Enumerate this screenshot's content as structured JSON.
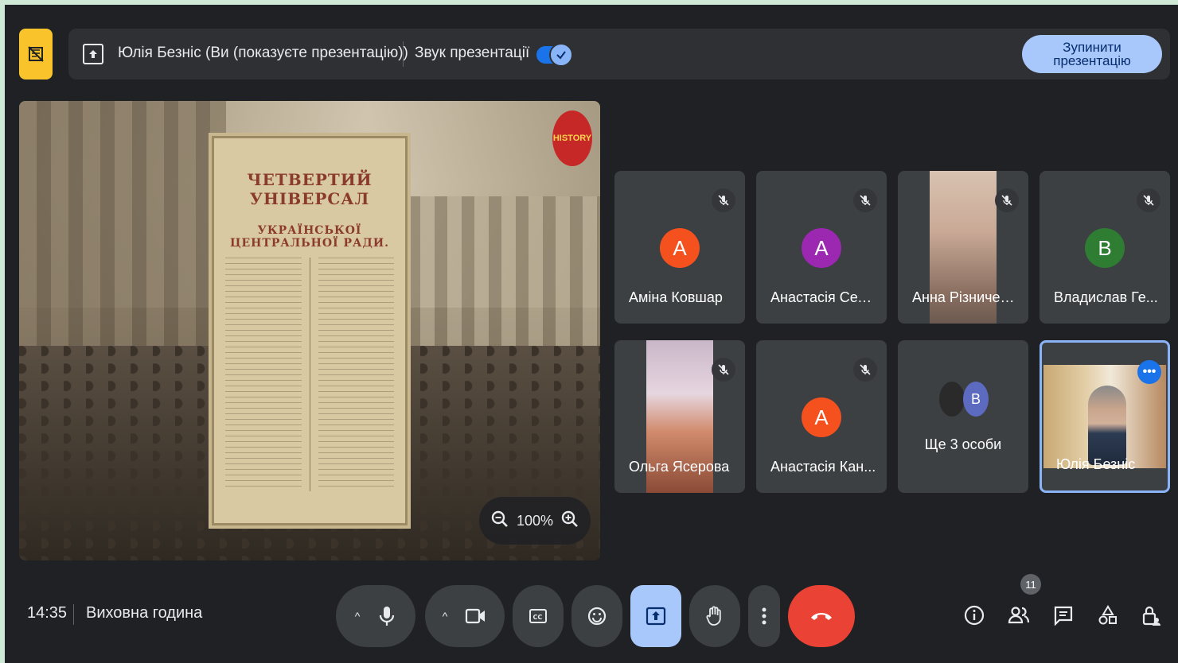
{
  "presenting_bar": {
    "status_text": "Юлія Безніс (Ви (показуєте презентацію))",
    "sound_label": "Звук презентації",
    "sound_enabled": true,
    "stop_button": "Зупинити презентацію"
  },
  "presentation": {
    "logo_text": "HISTORY",
    "doc_title_1": "ЧЕТВЕРТИЙ УНІВЕРСАЛ",
    "doc_title_2": "УКРАЇНСЬКОЇ ЦЕНТРАЛЬНОЇ РАДИ.",
    "zoom_level": "100%"
  },
  "participants": [
    {
      "name": "Аміна Ковшар",
      "initial": "А",
      "color": "#f4511e",
      "muted": true
    },
    {
      "name": "Анастасія Сел...",
      "initial": "А",
      "color": "#9c27b0",
      "muted": true
    },
    {
      "name": "Анна Різничен...",
      "initial": "",
      "color": "",
      "muted": true,
      "video": true
    },
    {
      "name": "Владислав Ге...",
      "initial": "В",
      "color": "#2e7d32",
      "muted": true
    },
    {
      "name": "Ольга Ясерова",
      "initial": "",
      "color": "",
      "muted": true,
      "video": true
    },
    {
      "name": "Анастасія Кан...",
      "initial": "А",
      "color": "#f4511e",
      "muted": true
    },
    {
      "name": "Ще 3 особи",
      "initial": "В",
      "color": "#5c6bc0",
      "muted": false
    },
    {
      "name": "Юлія Безніс",
      "initial": "",
      "color": "",
      "muted": false,
      "video": true,
      "self": true
    }
  ],
  "footer": {
    "time": "14:35",
    "meeting_name": "Виховна година",
    "participant_count": "11"
  }
}
